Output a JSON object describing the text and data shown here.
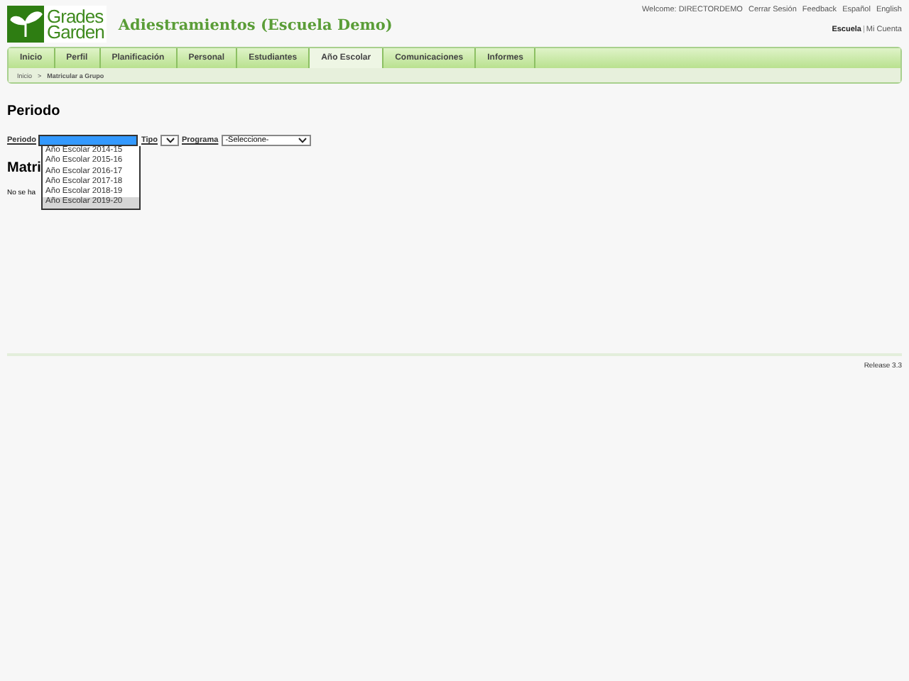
{
  "header": {
    "logo": [
      "Grades",
      "Garden"
    ],
    "title": "Adiestramientos (Escuela Demo)",
    "welcome": "Welcome: DIRECTORDEMO",
    "links": [
      "Cerrar Sesión",
      "Feedback",
      "Español",
      "English"
    ],
    "context": "Escuela",
    "divider": "|",
    "account": "Mi Cuenta"
  },
  "tabs": [
    {
      "label": "Inicio",
      "selected": false
    },
    {
      "label": "Perfil",
      "selected": false
    },
    {
      "label": "Planificación",
      "selected": false
    },
    {
      "label": "Personal",
      "selected": false
    },
    {
      "label": "Estudiantes",
      "selected": false
    },
    {
      "label": "Año Escolar",
      "selected": true
    },
    {
      "label": "Comunicaciones",
      "selected": false
    },
    {
      "label": "Informes",
      "selected": false
    }
  ],
  "breadcrumb": [
    "Inicio",
    "Matricular a Grupo"
  ],
  "breadcrumb_separator": ">",
  "heading": "Periodo",
  "form": {
    "periodo_label": "Periodo",
    "tipo_label": "Tipo",
    "programa_label": "Programa",
    "programa_value": "-Seleccione-"
  },
  "dropdown": [
    {
      "label": "Año Escolar 2014-15",
      "selected": false
    },
    {
      "label": "Año Escolar 2015-16",
      "selected": false
    },
    {
      "label": "Año Escolar 2016-17",
      "selected": false
    },
    {
      "label": "Año Escolar 2017-18",
      "selected": false
    },
    {
      "label": "Año Escolar 2018-19",
      "selected": false
    },
    {
      "label": "Año Escolar 2019-20",
      "selected": true
    }
  ],
  "section_heading": "Matri",
  "message": "No se ha",
  "footer": "Release 3.3"
}
